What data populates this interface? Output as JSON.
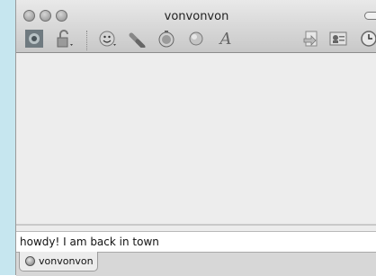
{
  "window": {
    "title": "vonvonvon"
  },
  "toolbar": {
    "items": [
      {
        "icon": "buddy-avatar-icon"
      },
      {
        "icon": "lock-icon"
      },
      {
        "icon": "smiley-icon"
      },
      {
        "icon": "link-icon"
      },
      {
        "icon": "timer-icon"
      },
      {
        "icon": "sound-icon"
      },
      {
        "icon": "font-icon",
        "glyph": "A"
      },
      {
        "icon": "send-file-icon"
      },
      {
        "icon": "contact-info-icon"
      },
      {
        "icon": "history-clock-icon"
      }
    ]
  },
  "message_input": {
    "value": "howdy!  I am back in town"
  },
  "tabs": [
    {
      "label": "vonvonvon",
      "icon": "status-icon"
    }
  ],
  "colors": {
    "background_shape": "#bfe3ee",
    "window_bg": "#ececec",
    "toolbar_gray": "#8a8a8a"
  }
}
